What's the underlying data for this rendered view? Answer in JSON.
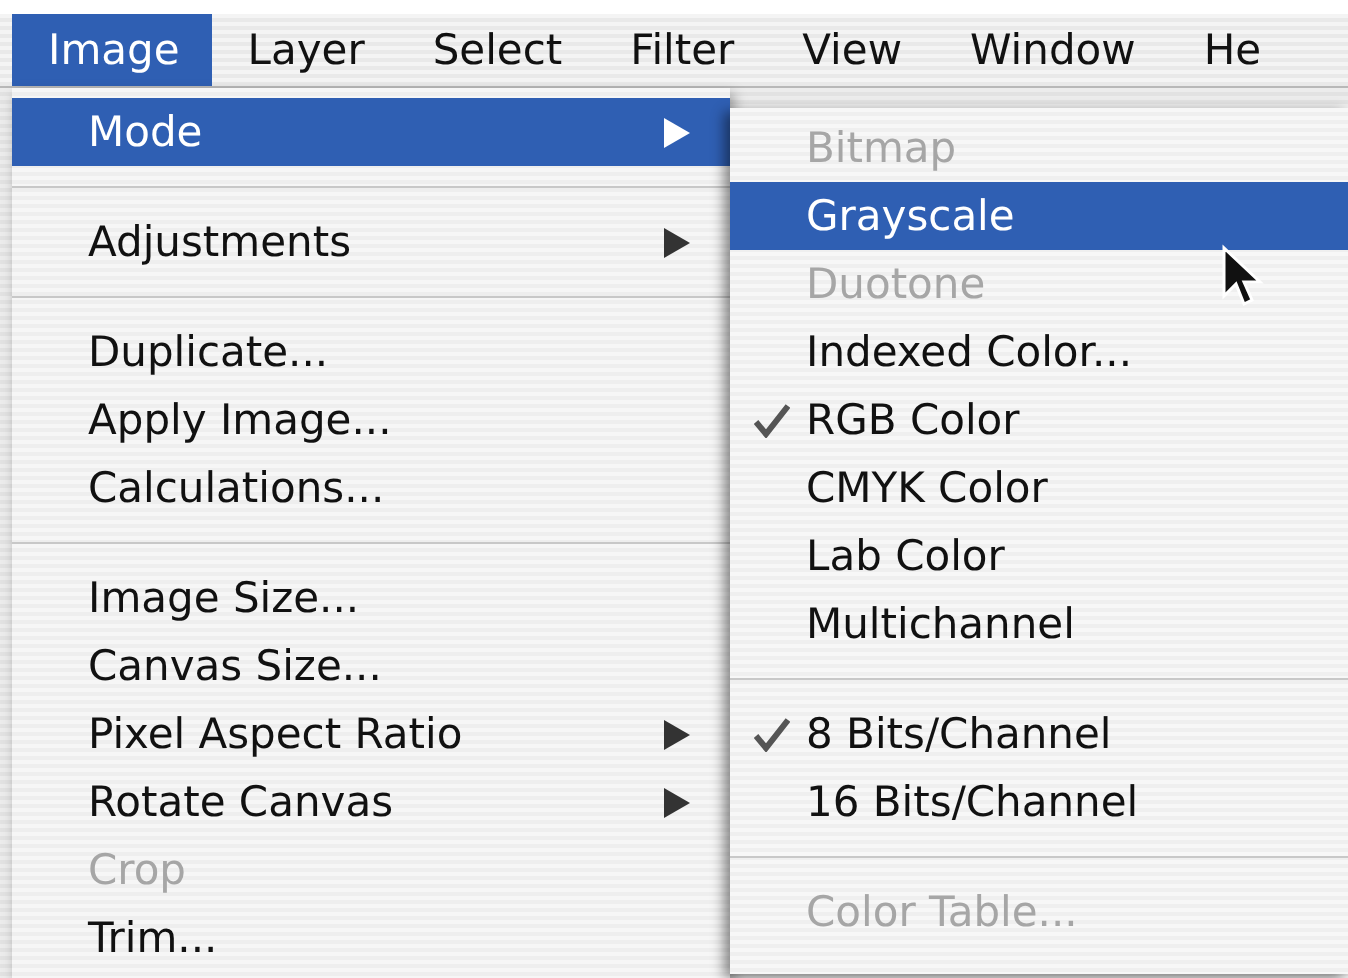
{
  "menubar": [
    {
      "label": "Image",
      "selected": true
    },
    {
      "label": "Layer",
      "selected": false
    },
    {
      "label": "Select",
      "selected": false
    },
    {
      "label": "Filter",
      "selected": false
    },
    {
      "label": "View",
      "selected": false
    },
    {
      "label": "Window",
      "selected": false
    },
    {
      "label": "He",
      "selected": false
    }
  ],
  "image_menu": [
    {
      "kind": "item",
      "label": "Mode",
      "submenu": true,
      "selected": true,
      "disabled": false
    },
    {
      "kind": "separator"
    },
    {
      "kind": "item",
      "label": "Adjustments",
      "submenu": true,
      "selected": false,
      "disabled": false
    },
    {
      "kind": "separator"
    },
    {
      "kind": "item",
      "label": "Duplicate...",
      "submenu": false,
      "selected": false,
      "disabled": false
    },
    {
      "kind": "item",
      "label": "Apply Image...",
      "submenu": false,
      "selected": false,
      "disabled": false
    },
    {
      "kind": "item",
      "label": "Calculations...",
      "submenu": false,
      "selected": false,
      "disabled": false
    },
    {
      "kind": "separator"
    },
    {
      "kind": "item",
      "label": "Image Size...",
      "submenu": false,
      "selected": false,
      "disabled": false
    },
    {
      "kind": "item",
      "label": "Canvas Size...",
      "submenu": false,
      "selected": false,
      "disabled": false
    },
    {
      "kind": "item",
      "label": "Pixel Aspect Ratio",
      "submenu": true,
      "selected": false,
      "disabled": false
    },
    {
      "kind": "item",
      "label": "Rotate Canvas",
      "submenu": true,
      "selected": false,
      "disabled": false
    },
    {
      "kind": "item",
      "label": "Crop",
      "submenu": false,
      "selected": false,
      "disabled": true
    },
    {
      "kind": "item",
      "label": "Trim...",
      "submenu": false,
      "selected": false,
      "disabled": false
    }
  ],
  "mode_submenu": [
    {
      "kind": "item",
      "label": "Bitmap",
      "checked": false,
      "selected": false,
      "disabled": true
    },
    {
      "kind": "item",
      "label": "Grayscale",
      "checked": false,
      "selected": true,
      "disabled": false
    },
    {
      "kind": "item",
      "label": "Duotone",
      "checked": false,
      "selected": false,
      "disabled": true
    },
    {
      "kind": "item",
      "label": "Indexed Color...",
      "checked": false,
      "selected": false,
      "disabled": false
    },
    {
      "kind": "item",
      "label": "RGB Color",
      "checked": true,
      "selected": false,
      "disabled": false
    },
    {
      "kind": "item",
      "label": "CMYK Color",
      "checked": false,
      "selected": false,
      "disabled": false
    },
    {
      "kind": "item",
      "label": "Lab Color",
      "checked": false,
      "selected": false,
      "disabled": false
    },
    {
      "kind": "item",
      "label": "Multichannel",
      "checked": false,
      "selected": false,
      "disabled": false
    },
    {
      "kind": "separator"
    },
    {
      "kind": "item",
      "label": "8 Bits/Channel",
      "checked": true,
      "selected": false,
      "disabled": false
    },
    {
      "kind": "item",
      "label": "16 Bits/Channel",
      "checked": false,
      "selected": false,
      "disabled": false
    },
    {
      "kind": "separator"
    },
    {
      "kind": "item",
      "label": "Color Table...",
      "checked": false,
      "selected": false,
      "disabled": true
    }
  ]
}
